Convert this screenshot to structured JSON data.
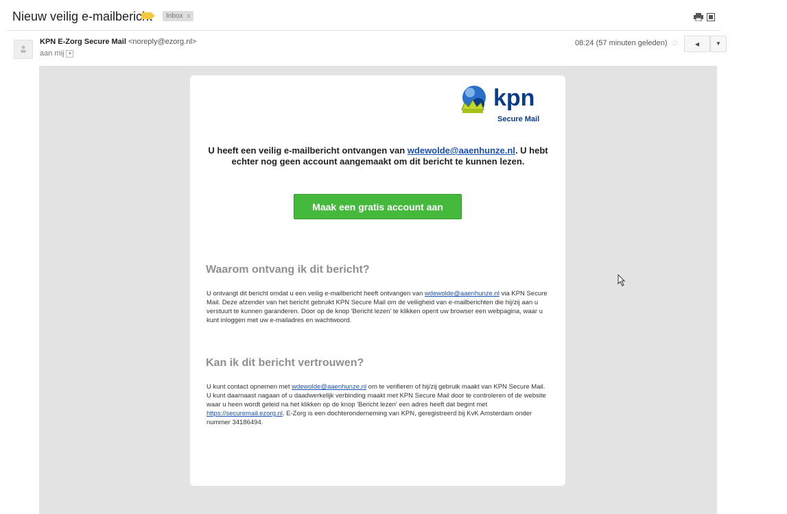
{
  "header": {
    "subject": "Nieuw veilig e-mailbericht",
    "label_chip": "Inbox",
    "label_chip_close": "x",
    "tag_color": "#f6c842"
  },
  "message": {
    "sender_name": "KPN E-Zorg Secure Mail",
    "sender_email": "<noreply@ezorg.nl>",
    "recipient": "aan mij",
    "time": "08:24 (57 minuten geleden)"
  },
  "email": {
    "logo_word": "kpn",
    "logo_sub": "Secure Mail",
    "intro_pre": "U heeft een veilig e-mailbericht ontvangen van ",
    "intro_link": "wdewolde@aaenhunze.nl",
    "intro_post": ". U hebt echter nog geen account aangemaakt om dit bericht te kunnen lezen.",
    "cta_label": "Maak een gratis account aan",
    "section1_title": "Waarom ontvang ik dit bericht?",
    "section1_pre": "U ontvangt dit bericht omdat u een veilig e-mailbericht heeft ontvangen van ",
    "section1_link": "wdewolde@aaenhunze.nl",
    "section1_post": " via KPN Secure Mail. Deze afzender van het bericht gebruikt KPN Secure Mail om de veiligheid van e-mailberichten die hij/zij aan u verstuurt te kunnen garanderen. Door op de knop 'Bericht lezen' te klikken opent uw browser een webpagina, waar u kunt inloggen met uw e-mailadres en wachtwoord.",
    "section2_title": "Kan ik dit bericht vertrouwen?",
    "section2_pre": "U kunt contact opnemen met ",
    "section2_link1": "wdewolde@aaenhunze.nl",
    "section2_mid": " om te verifieren of hij/zij gebruik maakt van KPN Secure Mail. U kunt daarnaast nagaan of u daadwerkelijk verbinding maakt met KPN Secure Mail door te controleren of de website waar u heen wordt geleid na het klikken op de knop 'Bericht lezen' een adres heeft dat begint met ",
    "section2_link2": "https://securemail.ezorg.nl",
    "section2_post": ". E-Zorg is een dochteronderneming van KPN, geregistreerd bij KvK Amsterdam onder nummer 34186494.",
    "brand_color": "#0a3c8a",
    "button_color": "#44b93c",
    "link_color": "#1a4fb5"
  },
  "icons": {
    "print": "print-icon",
    "new_window": "new-window-icon",
    "star": "star-icon",
    "reply": "reply-icon",
    "more": "chevron-down-icon"
  }
}
